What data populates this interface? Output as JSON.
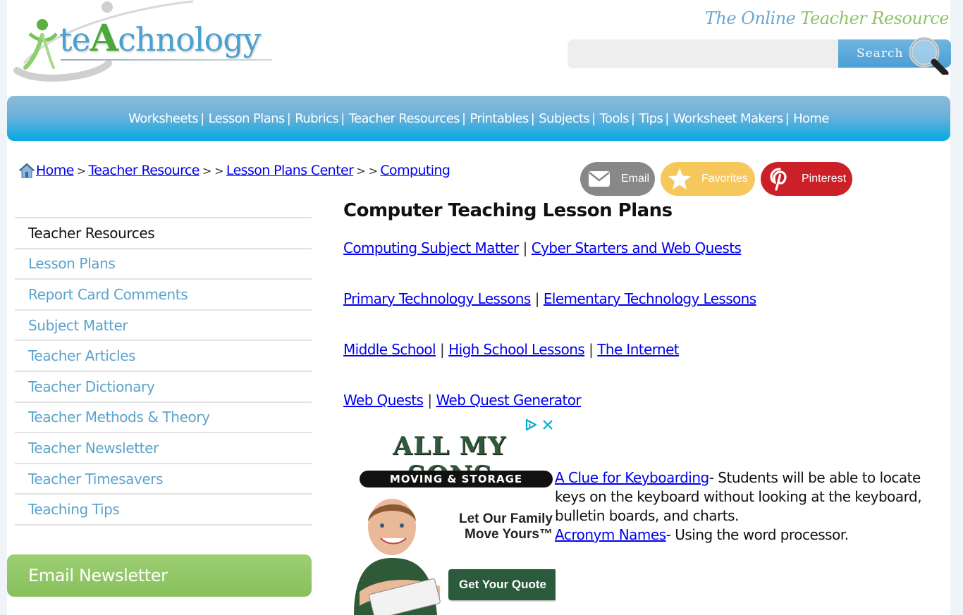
{
  "header": {
    "logo_prefix": "te",
    "logo_accent": "A",
    "logo_suffix": "chnology",
    "tagline_part1": "The Online",
    "tagline_part2": "Teacher Resource",
    "search": {
      "value": "",
      "placeholder": "",
      "button_label": "Search"
    }
  },
  "nav": {
    "items": [
      {
        "label": "Worksheets"
      },
      {
        "label": "Lesson Plans"
      },
      {
        "label": "Rubrics"
      },
      {
        "label": "Teacher Resources"
      },
      {
        "label": "Printables"
      },
      {
        "label": "Subjects"
      },
      {
        "label": "Tools"
      },
      {
        "label": "Tips"
      },
      {
        "label": "Worksheet Makers"
      },
      {
        "label": "Home"
      }
    ],
    "separator": "|"
  },
  "breadcrumb": {
    "items": [
      {
        "label": "Home"
      },
      {
        "label": "Teacher Resource"
      },
      {
        "label": "Lesson Plans Center"
      },
      {
        "label": "Computing"
      }
    ],
    "sep1": ">",
    "sep2": "> >"
  },
  "share": {
    "email": "Email",
    "favorites": "Favorites",
    "pinterest": "Pinterest"
  },
  "sidebar": {
    "heading": "Teacher Resources",
    "items": [
      {
        "label": "Lesson Plans"
      },
      {
        "label": "Report Card Comments"
      },
      {
        "label": "Subject Matter"
      },
      {
        "label": "Teacher Articles"
      },
      {
        "label": "Teacher Dictionary"
      },
      {
        "label": "Teacher Methods & Theory"
      },
      {
        "label": "Teacher Newsletter"
      },
      {
        "label": "Teacher Timesavers"
      },
      {
        "label": "Teaching Tips"
      }
    ],
    "newsletter_label": "Email Newsletter"
  },
  "main": {
    "title": "Computer Teaching Lesson Plans",
    "separator": "|",
    "link_rows": [
      [
        "Computing Subject Matter",
        "Cyber Starters and Web Quests"
      ],
      [
        "Primary Technology Lessons",
        "Elementary Technology Lessons"
      ],
      [
        "Middle School",
        "High School Lessons",
        "The Internet"
      ],
      [
        "Web Quests",
        "Web Quest Generator"
      ]
    ],
    "lessons": [
      {
        "title": "A Clue for Keyboarding",
        "description": "- Students will be able to locate keys on the keyboard without looking at the keyboard, bulletin boards, and charts."
      },
      {
        "title": "Acronym Names",
        "description": "- Using the word processor."
      }
    ]
  },
  "ad": {
    "brand": "ALL MY SONS",
    "subtitle": "MOVING & STORAGE",
    "tagline_line1": "Let Our Family",
    "tagline_line2": "Move Yours™",
    "cta": "Get Your Quote"
  },
  "colors": {
    "nav_top": "#8bbbd8",
    "nav_bottom": "#06aae0",
    "sidebar_link": "#5ba3cc",
    "link": "#0000ee",
    "newsletter": "#8fc563",
    "share_email": "#888888",
    "share_favorites": "#f6c85c",
    "share_pinterest": "#cb2027"
  }
}
